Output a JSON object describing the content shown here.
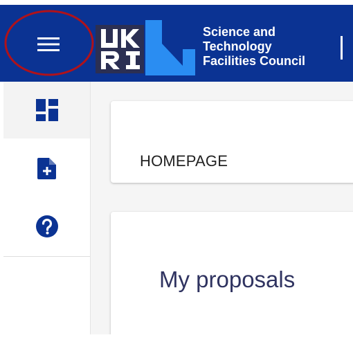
{
  "header": {
    "org_name_lines": [
      "Science and",
      "Technology",
      "Facilities Council"
    ],
    "logo_text": "UKRI",
    "background_color": "#0b3393"
  },
  "sidebar": {
    "items": [
      {
        "icon": "dashboard-icon",
        "active": true
      },
      {
        "icon": "add-document-icon",
        "active": false
      },
      {
        "icon": "help-icon",
        "active": false
      }
    ]
  },
  "main": {
    "breadcrumb": "HOMEPAGE",
    "proposals_title": "My proposals"
  },
  "colors": {
    "accent": "#0b3393",
    "highlight_circle": "#b0121a",
    "title_text": "#2f3360"
  }
}
